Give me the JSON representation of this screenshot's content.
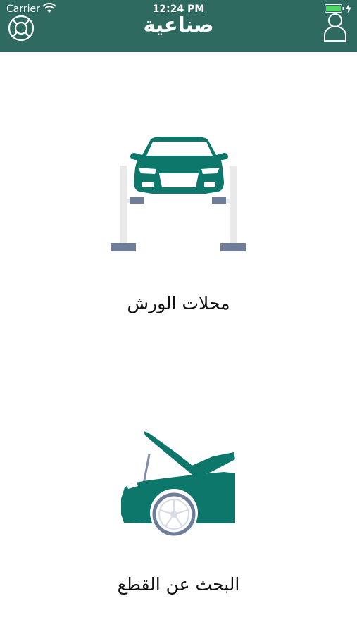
{
  "status_bar": {
    "carrier": "Carrier",
    "time": "12:24 PM"
  },
  "header": {
    "title": "صناعية",
    "left_icon": "lifebuoy-icon",
    "right_icon": "user-icon"
  },
  "menu": {
    "items": [
      {
        "label": "محلات الورش",
        "icon": "car-lift-icon"
      },
      {
        "label": "البحث عن القطع",
        "icon": "car-hood-open-icon"
      }
    ]
  },
  "colors": {
    "header_bg": "#2f6a60",
    "accent": "#0d776c",
    "slate": "#6e7d99",
    "lift_gray": "#e9e9ea"
  }
}
